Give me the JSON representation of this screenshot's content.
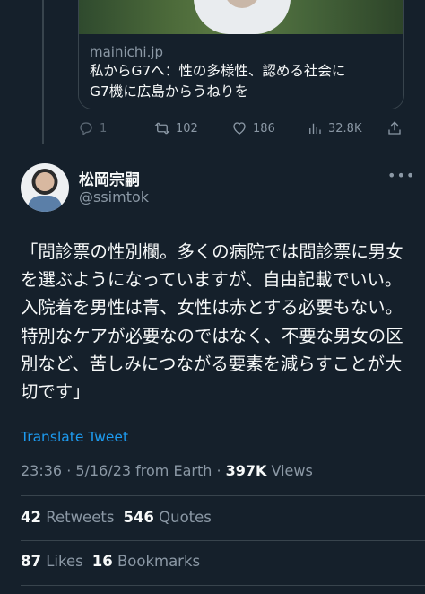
{
  "quoted_card": {
    "domain": "mainichi.jp",
    "title_line1": "私からG7へ：性の多様性、認める社会に",
    "title_line2": "G7機に広島からうねりを"
  },
  "actions": {
    "replies": "1",
    "retweets": "102",
    "likes": "186",
    "views": "32.8K",
    "icons": [
      "reply-icon",
      "retweet-icon",
      "like-icon",
      "views-icon",
      "share-icon"
    ]
  },
  "tweet": {
    "author_name": "松岡宗嗣",
    "author_handle": "@ssimtok",
    "text": "「問診票の性別欄。多くの病院では問診票に男女を選ぶようになっていますが、自由記載でいい。入院着を男性は青、女性は赤とする必要もない。特別なケアが必要なのではなく、不要な男女の区別など、苦しみにつながる要素を減らすことが大切です」",
    "translate_label": "Translate Tweet",
    "meta_time": "23:36 · 5/16/23 from Earth · ",
    "views_count": "397K",
    "views_label": " Views"
  },
  "stats": {
    "retweets_count": "42",
    "retweets_label": "Retweets",
    "quotes_count": "546",
    "quotes_label": "Quotes",
    "likes_count": "87",
    "likes_label": "Likes",
    "bookmarks_count": "16",
    "bookmarks_label": "Bookmarks"
  },
  "colors": {
    "background": "#15202b",
    "text": "#f7f9f9",
    "secondary": "#8b98a5",
    "link": "#1d9bf0",
    "border": "#38444d"
  }
}
